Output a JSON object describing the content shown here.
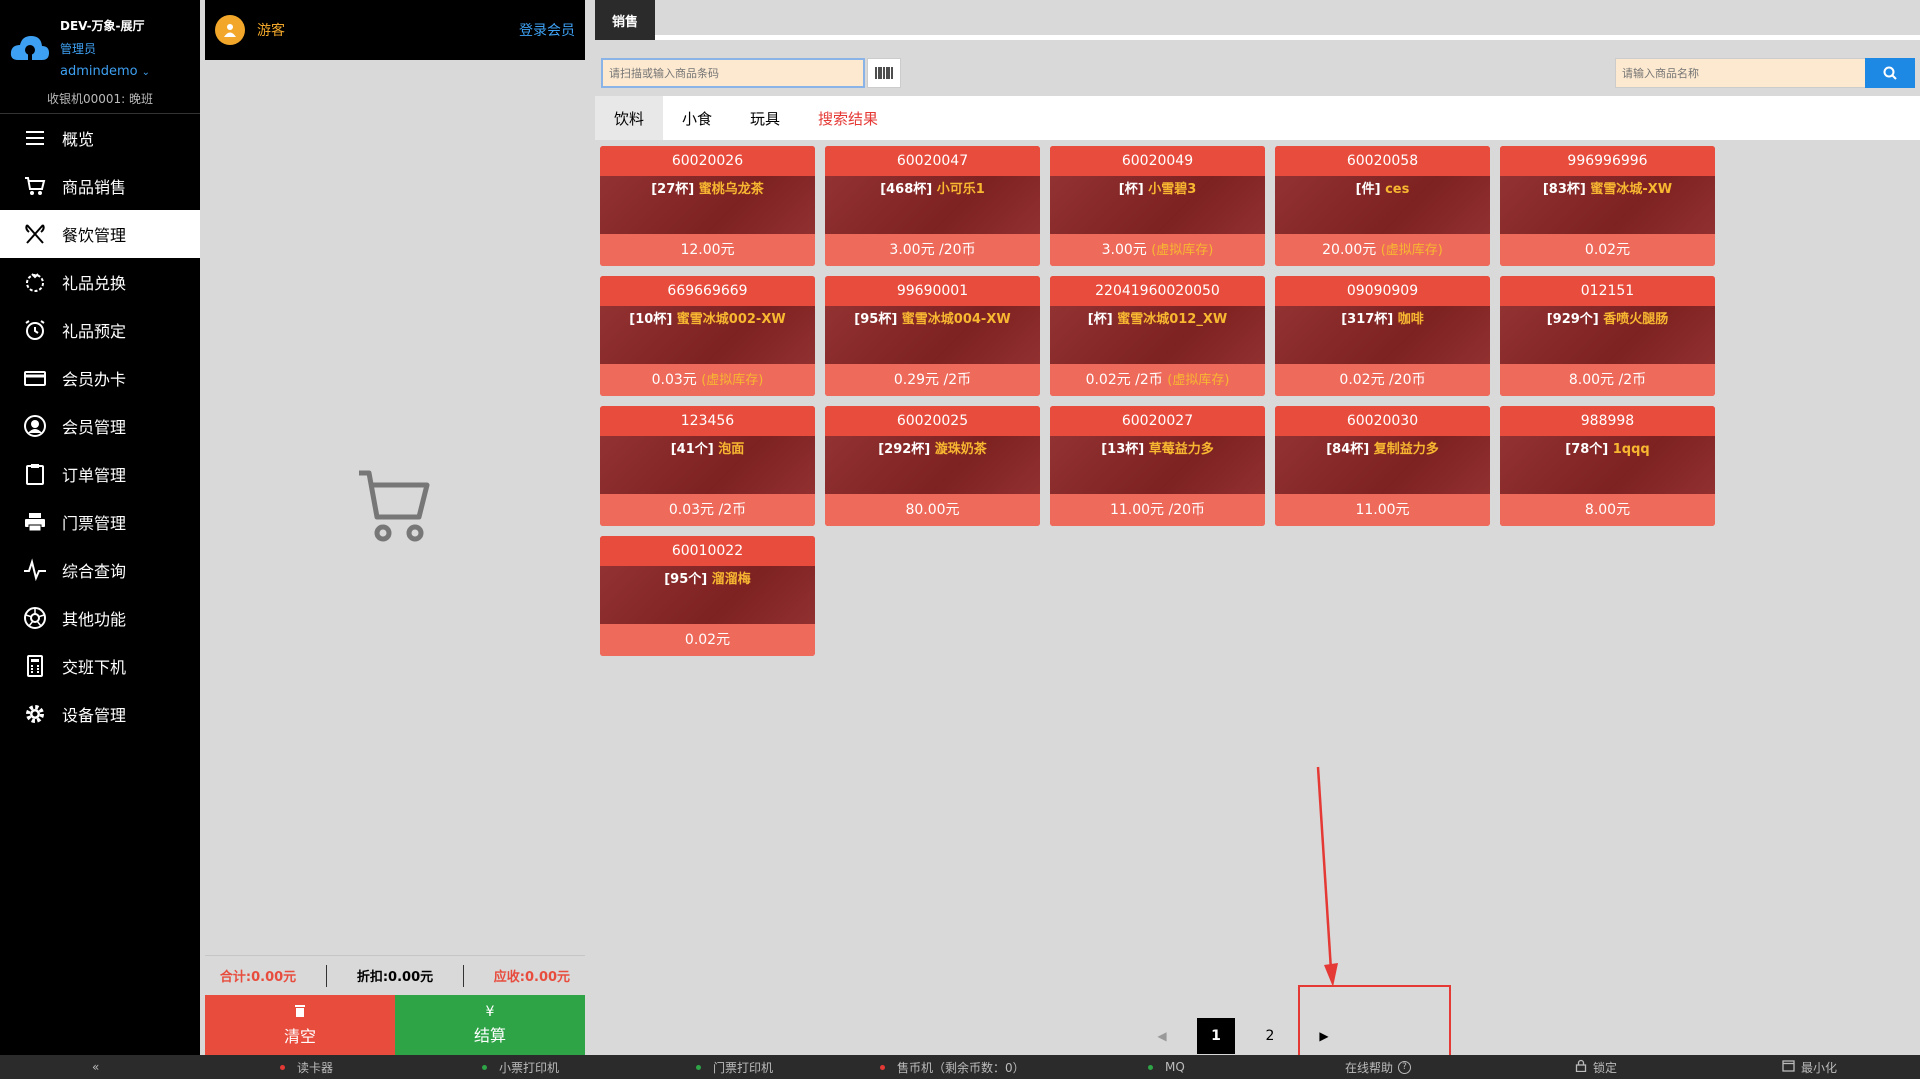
{
  "sidebar": {
    "store": "DEV-万象-展厅",
    "role": "管理员",
    "user": "admindemo",
    "cashier": "收银机00001: 晚班",
    "items": [
      {
        "label": "概览",
        "icon": "menu-icon"
      },
      {
        "label": "商品销售",
        "icon": "cart-icon"
      },
      {
        "label": "餐饮管理",
        "icon": "utensils-icon"
      },
      {
        "label": "礼品兑换",
        "icon": "gift-icon"
      },
      {
        "label": "礼品预定",
        "icon": "alarm-clock-icon"
      },
      {
        "label": "会员办卡",
        "icon": "credit-card-icon"
      },
      {
        "label": "会员管理",
        "icon": "user-circle-icon"
      },
      {
        "label": "订单管理",
        "icon": "clipboard-icon"
      },
      {
        "label": "门票管理",
        "icon": "printer-icon"
      },
      {
        "label": "综合查询",
        "icon": "pulse-icon"
      },
      {
        "label": "其他功能",
        "icon": "aperture-icon"
      },
      {
        "label": "交班下机",
        "icon": "calculator-icon"
      },
      {
        "label": "设备管理",
        "icon": "gear-icon"
      }
    ]
  },
  "cart": {
    "guest": "游客",
    "login": "登录会员",
    "total": "合计:0.00元",
    "discount": "折扣:0.00元",
    "receivable": "应收:0.00元",
    "clear": "清空",
    "pay": "结算",
    "pay_symbol": "¥"
  },
  "main": {
    "tab": "销售",
    "barcode_placeholder": "请扫描或输入商品条码",
    "name_placeholder": "请输入商品名称",
    "categories": [
      "饮料",
      "小食",
      "玩具",
      "搜索结果"
    ],
    "products": [
      {
        "code": "60020026",
        "stock": "[27杯]",
        "name": "蜜桃乌龙茶",
        "price": "12.00元",
        "extra": ""
      },
      {
        "code": "60020047",
        "stock": "[468杯]",
        "name": "小可乐1",
        "price": "3.00元 /20币",
        "extra": ""
      },
      {
        "code": "60020049",
        "stock": "[杯]",
        "name": "小雪碧3",
        "price": "3.00元",
        "extra": "(虚拟库存)"
      },
      {
        "code": "60020058",
        "stock": "[件]",
        "name": "ces",
        "price": "20.00元",
        "extra": "(虚拟库存)"
      },
      {
        "code": "996996996",
        "stock": "[83杯]",
        "name": "蜜雪冰城-XW",
        "price": "0.02元",
        "extra": ""
      },
      {
        "code": "669669669",
        "stock": "[10杯]",
        "name": "蜜雪冰城002-XW",
        "price": "0.03元",
        "extra": "(虚拟库存)"
      },
      {
        "code": "99690001",
        "stock": "[95杯]",
        "name": "蜜雪冰城004-XW",
        "price": "0.29元 /2币",
        "extra": ""
      },
      {
        "code": "22041960020050",
        "stock": "[杯]",
        "name": "蜜雪冰城012_XW",
        "price": "0.02元 /2币",
        "extra": "(虚拟库存)"
      },
      {
        "code": "09090909",
        "stock": "[317杯]",
        "name": "咖啡",
        "price": "0.02元 /20币",
        "extra": ""
      },
      {
        "code": "012151",
        "stock": "[929个]",
        "name": "香喷火腿肠",
        "price": "8.00元 /2币",
        "extra": ""
      },
      {
        "code": "123456",
        "stock": "[41个]",
        "name": "泡面",
        "price": "0.03元 /2币",
        "extra": ""
      },
      {
        "code": "60020025",
        "stock": "[292杯]",
        "name": "漩珠奶茶",
        "price": "80.00元",
        "extra": ""
      },
      {
        "code": "60020027",
        "stock": "[13杯]",
        "name": "草莓益力多",
        "price": "11.00元 /20币",
        "extra": ""
      },
      {
        "code": "60020030",
        "stock": "[84杯]",
        "name": "复制益力多",
        "price": "11.00元",
        "extra": ""
      },
      {
        "code": "988998",
        "stock": "[78个]",
        "name": "1qqq",
        "price": "8.00元",
        "extra": ""
      },
      {
        "code": "60010022",
        "stock": "[95个]",
        "name": "溜溜梅",
        "price": "0.02元",
        "extra": ""
      }
    ],
    "pages": [
      "1",
      "2"
    ],
    "current_page": "1"
  },
  "statusbar": {
    "collapse": "«",
    "card_reader": "读卡器",
    "receipt_printer": "小票打印机",
    "ticket_printer": "门票打印机",
    "coin_machine": "售币机（剩余币数：0）",
    "mq": "MQ",
    "help": "在线帮助",
    "lock": "锁定",
    "minimize": "最小化"
  },
  "colors": {
    "card_top": "#e84c3d",
    "card_mid": "#8c2525",
    "accent_blue": "#1e88e5",
    "pay_green": "#2ea447",
    "name_orange": "#f7b731"
  }
}
